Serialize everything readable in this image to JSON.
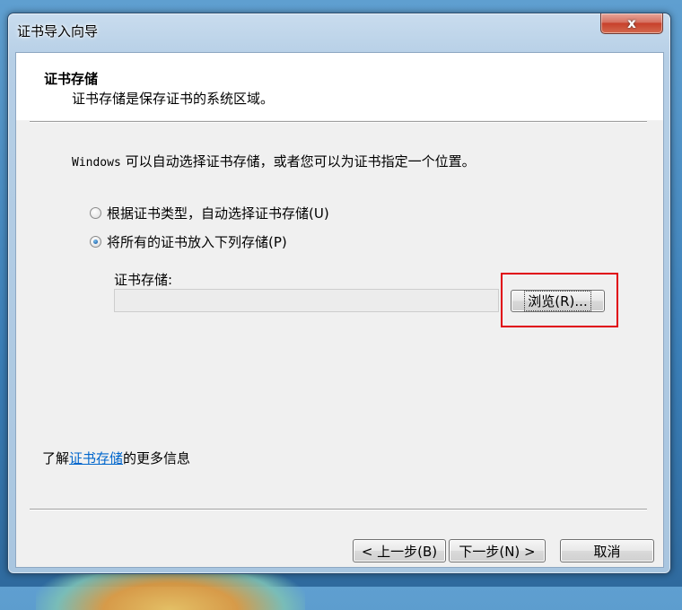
{
  "window": {
    "title": "证书导入向导",
    "close_label": "x"
  },
  "header": {
    "title": "证书存储",
    "subtitle": "证书存储是保存证书的系统区域。"
  },
  "main": {
    "intro_prefix": "Windows",
    "intro_rest": " 可以自动选择证书存储，或者您可以为证书指定一个位置。",
    "options": [
      {
        "label": "根据证书类型，自动选择证书存储(U)",
        "checked": false
      },
      {
        "label": "将所有的证书放入下列存储(P)",
        "checked": true
      }
    ],
    "store_label": "证书存储:",
    "store_value": "",
    "browse_label": "浏览(R)..."
  },
  "footer": {
    "learn_prefix": "了解",
    "learn_link": "证书存储",
    "learn_suffix": "的更多信息",
    "back_label": "< 上一步(B)",
    "next_label": "下一步(N) >",
    "cancel_label": "取消"
  },
  "colors": {
    "highlight": "#e0000f",
    "link": "#0066cc"
  }
}
